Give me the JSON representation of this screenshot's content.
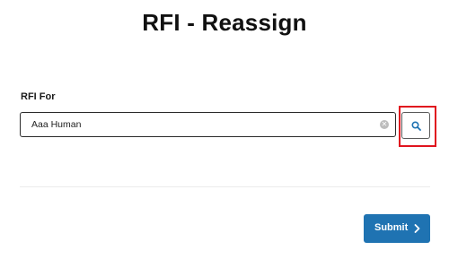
{
  "page": {
    "title": "RFI - Reassign"
  },
  "form": {
    "rfi_for_label": "RFI For",
    "rfi_for_value": "Aaa Human",
    "clear_icon": "clear-icon",
    "search_icon": "search-icon"
  },
  "actions": {
    "submit_label": "Submit",
    "submit_icon": "chevron-right-icon"
  },
  "colors": {
    "accent": "#1f73b2",
    "highlight": "#e0141e"
  }
}
